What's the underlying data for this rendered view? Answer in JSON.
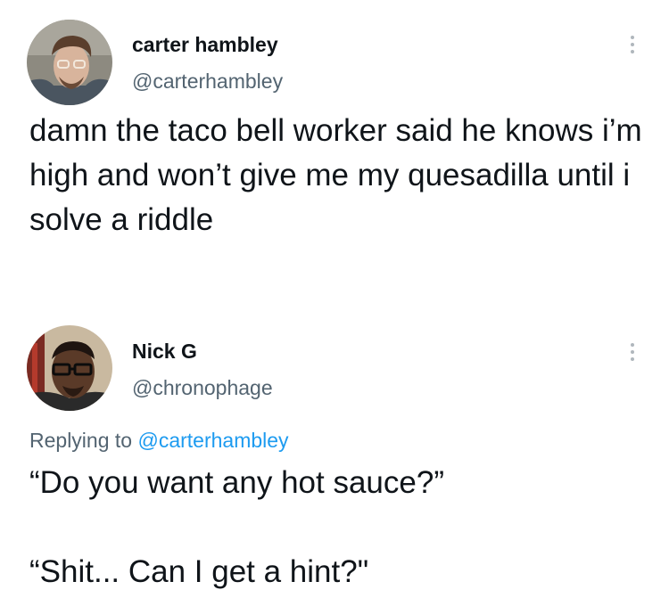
{
  "tweets": [
    {
      "author": {
        "name": "carter hambley",
        "handle": "@carterhambley"
      },
      "text": "damn the taco bell worker said he knows i’m high and won’t give me my quesadilla until i solve a riddle",
      "menu_icon": "more-vertical-icon"
    },
    {
      "author": {
        "name": "Nick G",
        "handle": "@chronophage"
      },
      "replying_to_label": "Replying to",
      "replying_to_handle": "@carterhambley",
      "text_lines": [
        "“Do you want any hot sauce?”",
        "“Shit... Can I get a hint?\""
      ],
      "menu_icon": "more-vertical-icon"
    }
  ],
  "colors": {
    "text": "#0f1419",
    "secondary": "#536471",
    "link": "#1d9bf0",
    "background": "#ffffff"
  }
}
